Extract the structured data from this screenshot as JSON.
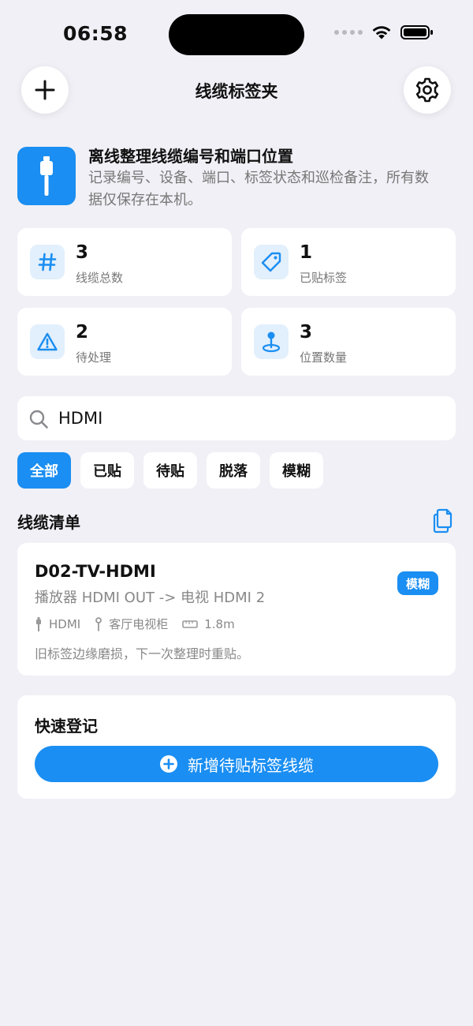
{
  "status_bar": {
    "time": "06:58"
  },
  "nav": {
    "title": "线缆标签夹"
  },
  "intro": {
    "title": "离线整理线缆编号和端口位置",
    "description": "记录编号、设备、端口、标签状态和巡检备注，所有数据仅保存在本机。"
  },
  "stats": [
    {
      "value": "3",
      "label": "线缆总数",
      "icon": "hash-icon"
    },
    {
      "value": "1",
      "label": "已贴标签",
      "icon": "tag-icon"
    },
    {
      "value": "2",
      "label": "待处理",
      "icon": "warning-icon"
    },
    {
      "value": "3",
      "label": "位置数量",
      "icon": "location-pin-icon"
    }
  ],
  "search": {
    "value": "HDMI"
  },
  "filters": [
    "全部",
    "已贴",
    "待贴",
    "脱落",
    "模糊"
  ],
  "list": {
    "title": "线缆清单"
  },
  "cables": [
    {
      "id": "D02-TV-HDMI",
      "route": "播放器 HDMI OUT -> 电视 HDMI 2",
      "status": "模糊",
      "type": "HDMI",
      "location": "客厅电视柜",
      "length": "1.8m",
      "note": "旧标签边缘磨损，下一次整理时重贴。"
    }
  ],
  "quick": {
    "title": "快速登记",
    "button_label": "新增待贴标签线缆"
  },
  "colors": {
    "accent": "#1a8ef2",
    "background": "#f0f0f6",
    "card": "#ffffff",
    "icon_bg": "#e2effc"
  }
}
